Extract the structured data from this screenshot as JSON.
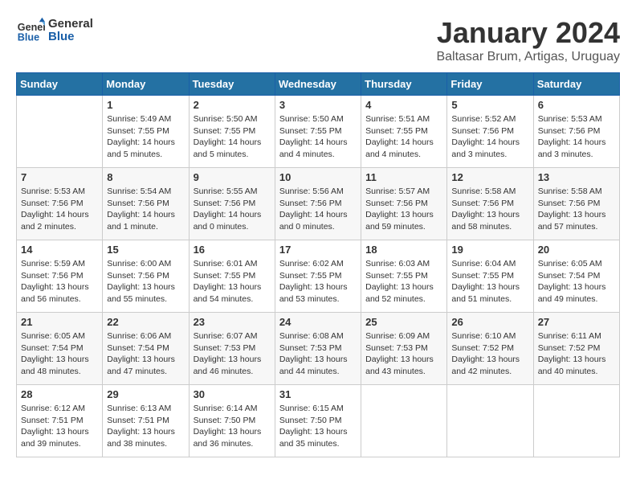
{
  "header": {
    "logo_text_general": "General",
    "logo_text_blue": "Blue",
    "title": "January 2024",
    "subtitle": "Baltasar Brum, Artigas, Uruguay"
  },
  "days_of_week": [
    "Sunday",
    "Monday",
    "Tuesday",
    "Wednesday",
    "Thursday",
    "Friday",
    "Saturday"
  ],
  "weeks": [
    [
      {
        "day": "",
        "info": ""
      },
      {
        "day": "1",
        "info": "Sunrise: 5:49 AM\nSunset: 7:55 PM\nDaylight: 14 hours\nand 5 minutes."
      },
      {
        "day": "2",
        "info": "Sunrise: 5:50 AM\nSunset: 7:55 PM\nDaylight: 14 hours\nand 5 minutes."
      },
      {
        "day": "3",
        "info": "Sunrise: 5:50 AM\nSunset: 7:55 PM\nDaylight: 14 hours\nand 4 minutes."
      },
      {
        "day": "4",
        "info": "Sunrise: 5:51 AM\nSunset: 7:55 PM\nDaylight: 14 hours\nand 4 minutes."
      },
      {
        "day": "5",
        "info": "Sunrise: 5:52 AM\nSunset: 7:56 PM\nDaylight: 14 hours\nand 3 minutes."
      },
      {
        "day": "6",
        "info": "Sunrise: 5:53 AM\nSunset: 7:56 PM\nDaylight: 14 hours\nand 3 minutes."
      }
    ],
    [
      {
        "day": "7",
        "info": "Sunrise: 5:53 AM\nSunset: 7:56 PM\nDaylight: 14 hours\nand 2 minutes."
      },
      {
        "day": "8",
        "info": "Sunrise: 5:54 AM\nSunset: 7:56 PM\nDaylight: 14 hours\nand 1 minute."
      },
      {
        "day": "9",
        "info": "Sunrise: 5:55 AM\nSunset: 7:56 PM\nDaylight: 14 hours\nand 0 minutes."
      },
      {
        "day": "10",
        "info": "Sunrise: 5:56 AM\nSunset: 7:56 PM\nDaylight: 14 hours\nand 0 minutes."
      },
      {
        "day": "11",
        "info": "Sunrise: 5:57 AM\nSunset: 7:56 PM\nDaylight: 13 hours\nand 59 minutes."
      },
      {
        "day": "12",
        "info": "Sunrise: 5:58 AM\nSunset: 7:56 PM\nDaylight: 13 hours\nand 58 minutes."
      },
      {
        "day": "13",
        "info": "Sunrise: 5:58 AM\nSunset: 7:56 PM\nDaylight: 13 hours\nand 57 minutes."
      }
    ],
    [
      {
        "day": "14",
        "info": "Sunrise: 5:59 AM\nSunset: 7:56 PM\nDaylight: 13 hours\nand 56 minutes."
      },
      {
        "day": "15",
        "info": "Sunrise: 6:00 AM\nSunset: 7:56 PM\nDaylight: 13 hours\nand 55 minutes."
      },
      {
        "day": "16",
        "info": "Sunrise: 6:01 AM\nSunset: 7:55 PM\nDaylight: 13 hours\nand 54 minutes."
      },
      {
        "day": "17",
        "info": "Sunrise: 6:02 AM\nSunset: 7:55 PM\nDaylight: 13 hours\nand 53 minutes."
      },
      {
        "day": "18",
        "info": "Sunrise: 6:03 AM\nSunset: 7:55 PM\nDaylight: 13 hours\nand 52 minutes."
      },
      {
        "day": "19",
        "info": "Sunrise: 6:04 AM\nSunset: 7:55 PM\nDaylight: 13 hours\nand 51 minutes."
      },
      {
        "day": "20",
        "info": "Sunrise: 6:05 AM\nSunset: 7:54 PM\nDaylight: 13 hours\nand 49 minutes."
      }
    ],
    [
      {
        "day": "21",
        "info": "Sunrise: 6:05 AM\nSunset: 7:54 PM\nDaylight: 13 hours\nand 48 minutes."
      },
      {
        "day": "22",
        "info": "Sunrise: 6:06 AM\nSunset: 7:54 PM\nDaylight: 13 hours\nand 47 minutes."
      },
      {
        "day": "23",
        "info": "Sunrise: 6:07 AM\nSunset: 7:53 PM\nDaylight: 13 hours\nand 46 minutes."
      },
      {
        "day": "24",
        "info": "Sunrise: 6:08 AM\nSunset: 7:53 PM\nDaylight: 13 hours\nand 44 minutes."
      },
      {
        "day": "25",
        "info": "Sunrise: 6:09 AM\nSunset: 7:53 PM\nDaylight: 13 hours\nand 43 minutes."
      },
      {
        "day": "26",
        "info": "Sunrise: 6:10 AM\nSunset: 7:52 PM\nDaylight: 13 hours\nand 42 minutes."
      },
      {
        "day": "27",
        "info": "Sunrise: 6:11 AM\nSunset: 7:52 PM\nDaylight: 13 hours\nand 40 minutes."
      }
    ],
    [
      {
        "day": "28",
        "info": "Sunrise: 6:12 AM\nSunset: 7:51 PM\nDaylight: 13 hours\nand 39 minutes."
      },
      {
        "day": "29",
        "info": "Sunrise: 6:13 AM\nSunset: 7:51 PM\nDaylight: 13 hours\nand 38 minutes."
      },
      {
        "day": "30",
        "info": "Sunrise: 6:14 AM\nSunset: 7:50 PM\nDaylight: 13 hours\nand 36 minutes."
      },
      {
        "day": "31",
        "info": "Sunrise: 6:15 AM\nSunset: 7:50 PM\nDaylight: 13 hours\nand 35 minutes."
      },
      {
        "day": "",
        "info": ""
      },
      {
        "day": "",
        "info": ""
      },
      {
        "day": "",
        "info": ""
      }
    ]
  ]
}
